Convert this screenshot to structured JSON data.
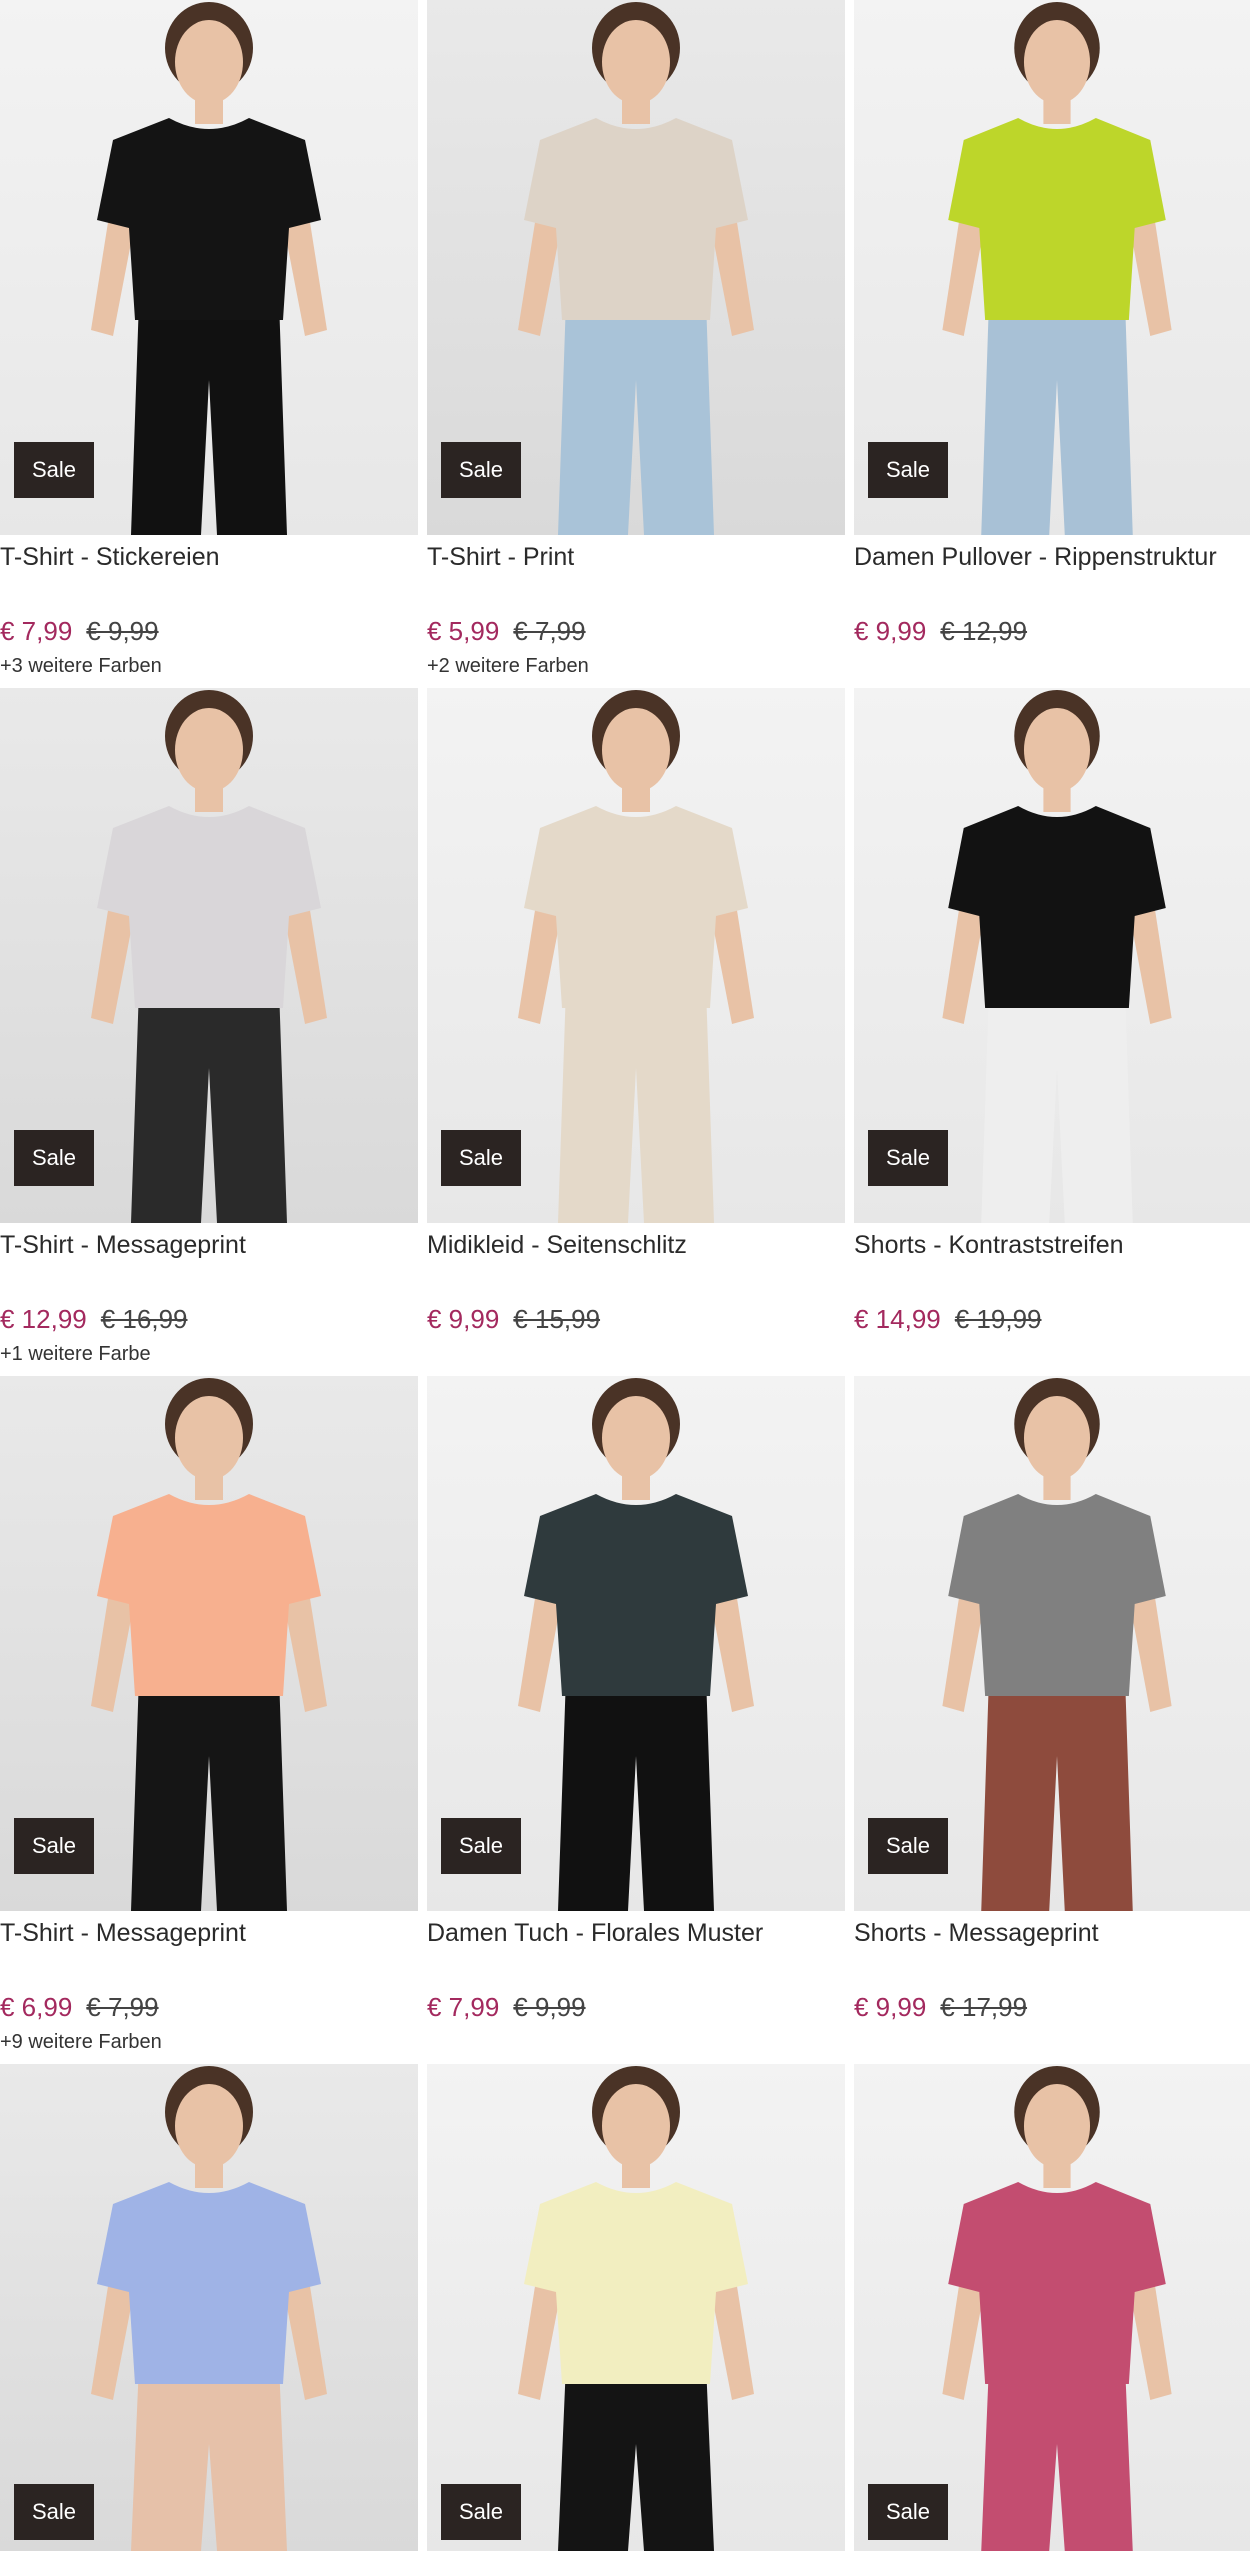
{
  "sale_label": "Sale",
  "products": [
    {
      "title": "T-Shirt - Stickereien",
      "price": "€ 7,99",
      "old_price": "€ 9,99",
      "colors": "+3 weitere Farben",
      "garment": "#141414",
      "lower": "#111111",
      "tone": "light"
    },
    {
      "title": "T-Shirt - Print",
      "price": "€ 5,99",
      "old_price": "€ 7,99",
      "colors": "+2 weitere Farben",
      "garment": "#ddd3c7",
      "lower": "#a9c3d8",
      "tone": "dark"
    },
    {
      "title": "Damen Pullover - Rippenstruktur",
      "price": "€ 9,99",
      "old_price": "€ 12,99",
      "colors": "",
      "garment": "#bdd62a",
      "lower": "#a8c1d6",
      "tone": "light"
    },
    {
      "title": "T-Shirt - Messageprint",
      "price": "€ 12,99",
      "old_price": "€ 16,99",
      "colors": "+1 weitere Farbe",
      "garment": "#d9d6d9",
      "lower": "#2a2a2a",
      "tone": "dark"
    },
    {
      "title": "Midikleid - Seitenschlitz",
      "price": "€ 9,99",
      "old_price": "€ 15,99",
      "colors": "",
      "garment": "#e4d9c9",
      "lower": "#e4d9c9",
      "tone": "light"
    },
    {
      "title": "Shorts - Kontraststreifen",
      "price": "€ 14,99",
      "old_price": "€ 19,99",
      "colors": "",
      "garment": "#121212",
      "lower": "#eeeeee",
      "tone": "light"
    },
    {
      "title": "T-Shirt - Messageprint",
      "price": "€ 6,99",
      "old_price": "€ 7,99",
      "colors": "+9 weitere Farben",
      "garment": "#f7b08f",
      "lower": "#151515",
      "tone": "dark"
    },
    {
      "title": "Damen Tuch - Florales Muster",
      "price": "€ 7,99",
      "old_price": "€ 9,99",
      "colors": "",
      "garment": "#2f3a3d",
      "lower": "#111111",
      "tone": "light"
    },
    {
      "title": "Shorts - Messageprint",
      "price": "€ 9,99",
      "old_price": "€ 17,99",
      "colors": "",
      "garment": "#808080",
      "lower": "#8e4b3d",
      "tone": "light"
    },
    {
      "title": "",
      "price": "",
      "old_price": "",
      "colors": "",
      "garment": "#9fb3e6",
      "lower": "#e6c1a9",
      "tone": "dark"
    },
    {
      "title": "",
      "price": "",
      "old_price": "",
      "colors": "",
      "garment": "#f2eec0",
      "lower": "#141414",
      "tone": "light"
    },
    {
      "title": "",
      "price": "",
      "old_price": "",
      "colors": "",
      "garment": "#c34d70",
      "lower": "#c34d70",
      "tone": "light"
    }
  ]
}
